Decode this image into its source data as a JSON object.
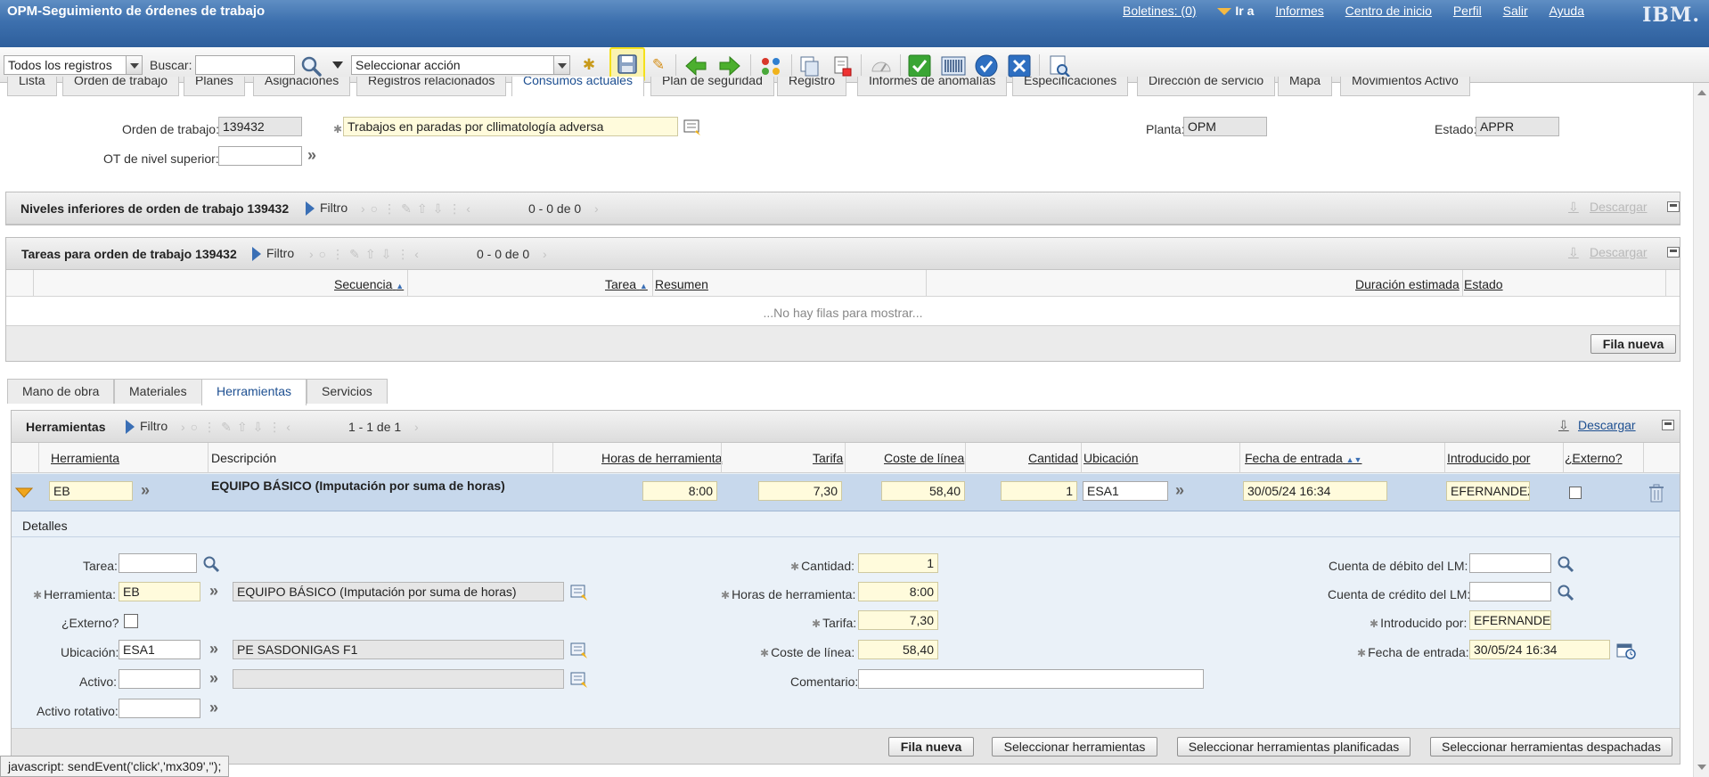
{
  "header": {
    "app_title": "OPM-Seguimiento de órdenes de trabajo",
    "links": [
      "Boletines: (0)",
      "Informes",
      "Centro de inicio",
      "Perfil",
      "Salir",
      "Ayuda"
    ],
    "goto_label": "Ir a",
    "logo": "IBM."
  },
  "toolbar": {
    "query_select": "Todos los registros",
    "search_label": "Buscar:",
    "search_value": "",
    "action_select": "Seleccionar acción",
    "icons": [
      "new-record-icon",
      "save-icon",
      "clear-changes-icon",
      "previous-record-icon",
      "next-record-icon",
      "workflow-icon",
      "duplicate-icon",
      "print-icon",
      "gauge-icon",
      "approve-icon",
      "barcode-icon",
      "complete-icon",
      "cancel-icon",
      "report-icon"
    ]
  },
  "main_tabs": [
    "Lista",
    "Orden de trabajo",
    "Planes",
    "Asignaciones",
    "Registros relacionados",
    "Consumos actuales",
    "Plan de seguridad",
    "Registro",
    "Informes de anomalías",
    "Especificaciones",
    "Dirección de servicio",
    "Mapa",
    "Movimientos Activo"
  ],
  "main_tab_active": 5,
  "work_order": {
    "wo_label": "Orden de trabajo:",
    "wo_value": "139432",
    "description": "Trabajos en paradas por cllimatología adversa",
    "parent_label": "OT de nivel superior:",
    "parent_value": "",
    "site_label": "Planta:",
    "site_value": "OPM",
    "status_label": "Estado:",
    "status_value": "APPR"
  },
  "children_section": {
    "title": "Niveles inferiores de orden de trabajo 139432",
    "filter": "Filtro",
    "count": "0 - 0 de 0",
    "download": "Descargar"
  },
  "tasks_section": {
    "title": "Tareas para orden de trabajo 139432",
    "filter": "Filtro",
    "count": "0 - 0 de 0",
    "download": "Descargar",
    "columns": [
      "Secuencia",
      "Tarea",
      "Resumen",
      "Duración estimada",
      "Estado"
    ],
    "empty_message": "...No hay filas para mostrar...",
    "new_row": "Fila nueva"
  },
  "sub_tabs": [
    "Mano de obra",
    "Materiales",
    "Herramientas",
    "Servicios"
  ],
  "sub_tab_active": 2,
  "tools_section": {
    "title": "Herramientas",
    "filter": "Filtro",
    "count": "1 - 1 de 1",
    "download": "Descargar",
    "columns": [
      "Herramienta",
      "Descripción",
      "Horas de herramienta",
      "Tarifa",
      "Coste de línea",
      "Cantidad",
      "Ubicación",
      "Fecha de entrada",
      "Introducido por",
      "¿Externo?"
    ],
    "row": {
      "tool": "EB",
      "description": "EQUIPO BÁSICO (Imputación por suma de horas)",
      "hours": "8:00",
      "rate": "7,30",
      "line_cost": "58,40",
      "quantity": "1",
      "location": "ESA1",
      "entry_date": "30/05/24 16:34",
      "entered_by": "EFERNANDEZ"
    },
    "details": {
      "title": "Detalles",
      "task_label": "Tarea:",
      "task_value": "",
      "tool_label": "Herramienta:",
      "tool_value": "EB",
      "tool_desc": "EQUIPO BÁSICO (Imputación por suma de horas)",
      "external_label": "¿Externo?",
      "location_label": "Ubicación:",
      "location_value": "ESA1",
      "location_desc": "PE SASDONIGAS F1",
      "asset_label": "Activo:",
      "asset_value": "",
      "asset_desc": "",
      "rotating_label": "Activo rotativo:",
      "rotating_value": "",
      "quantity_label": "Cantidad:",
      "quantity_value": "1",
      "hours_label": "Horas de herramienta:",
      "hours_value": "8:00",
      "rate_label": "Tarifa:",
      "rate_value": "7,30",
      "cost_label": "Coste de línea:",
      "cost_value": "58,40",
      "comment_label": "Comentario:",
      "comment_value": "",
      "debit_label": "Cuenta de débito del LM:",
      "debit_value": "",
      "credit_label": "Cuenta de crédito del LM:",
      "credit_value": "",
      "entered_by_label": "Introducido por:",
      "entered_by_value": "EFERNANDEZ",
      "entry_date_label": "Fecha de entrada:",
      "entry_date_value": "30/05/24 16:34"
    },
    "buttons": [
      "Fila nueva",
      "Seleccionar herramientas",
      "Seleccionar herramientas planificadas",
      "Seleccionar herramientas despachadas"
    ]
  },
  "status_tip": "javascript: sendEvent('click','mx309','');"
}
